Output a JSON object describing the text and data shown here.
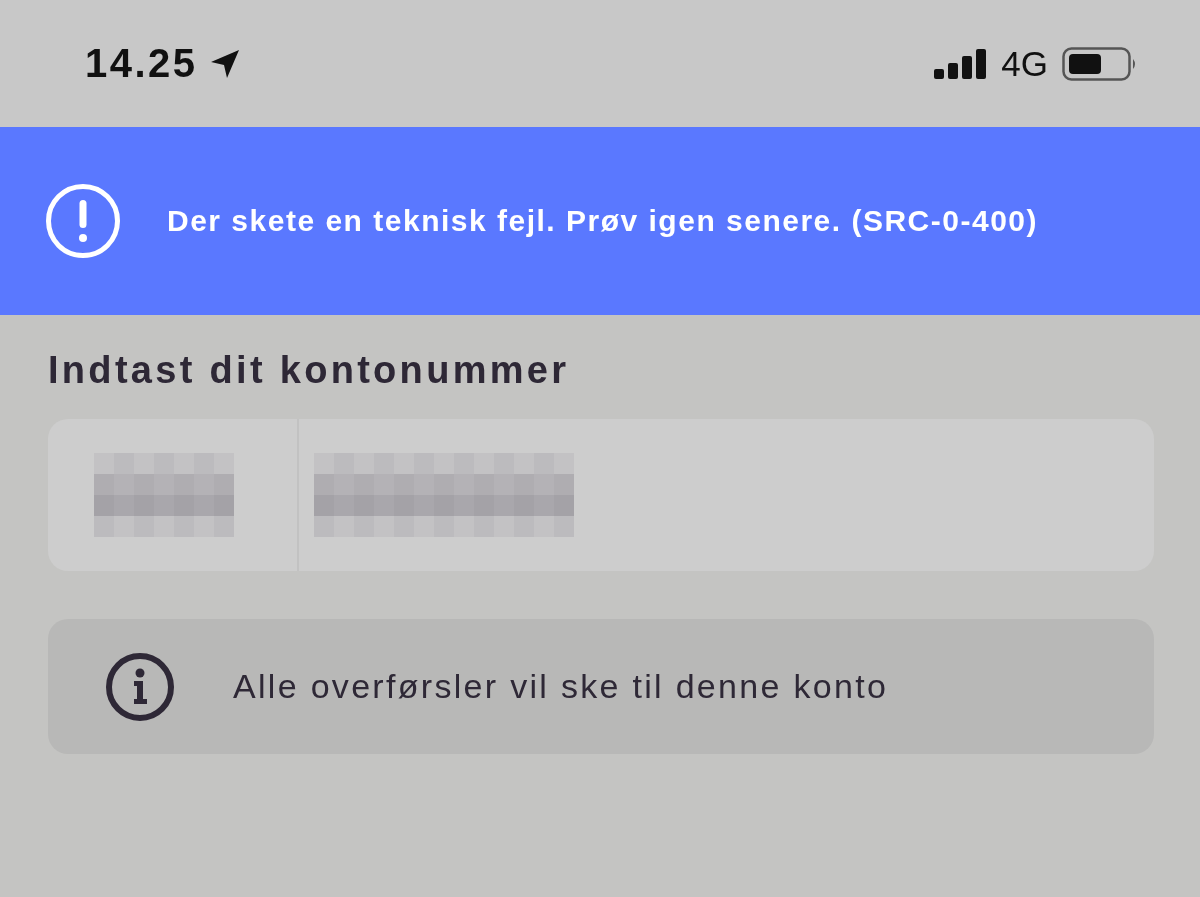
{
  "status_bar": {
    "time": "14.25",
    "network": "4G"
  },
  "banner": {
    "message": "Der skete en teknisk fejl. Prøv igen senere. (SRC-0-400)"
  },
  "heading": "Indtast dit kontonummer",
  "account_field": {
    "parts": [
      {
        "redacted": true
      },
      {
        "redacted": true
      }
    ]
  },
  "info": {
    "text": "Alle overførsler vil ske til denne konto"
  }
}
